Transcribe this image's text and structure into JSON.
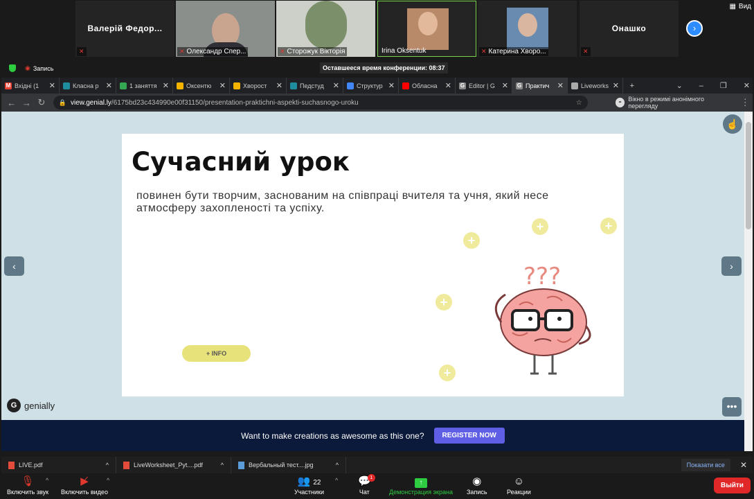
{
  "zoom": {
    "participants": [
      {
        "name": "Валерій Федор...",
        "caption": ""
      },
      {
        "name": "",
        "caption": "Олександр Спер..."
      },
      {
        "name": "",
        "caption": "Сторожук Вікторія"
      },
      {
        "name": "",
        "caption": "Irina Oksentuk"
      },
      {
        "name": "",
        "caption": "Катерина Хворо..."
      },
      {
        "name": "Онашко",
        "caption": ""
      }
    ],
    "view_label": "Вид",
    "recording_label": "Запись",
    "time_remaining": "Оставшееся время конференции: 08:37",
    "toolbar": {
      "unmute": "Включить звук",
      "start_video": "Включить видео",
      "participants": "Участники",
      "participants_count": "22",
      "chat": "Чат",
      "chat_badge": "1",
      "share_screen": "Демонстрация экрана",
      "record": "Запись",
      "reactions": "Реакции",
      "leave": "Выйти"
    }
  },
  "browser": {
    "tabs": [
      {
        "label": "Вхідні (1",
        "color": "#ea4335",
        "glyph": "M"
      },
      {
        "label": "Класна р",
        "color": "#1e8e9e",
        "glyph": ""
      },
      {
        "label": "1 заняття",
        "color": "#34a853",
        "glyph": ""
      },
      {
        "label": "Оксентю",
        "color": "#f4b400",
        "glyph": ""
      },
      {
        "label": "Хворост",
        "color": "#f4b400",
        "glyph": ""
      },
      {
        "label": "Педстуд",
        "color": "#1e8e9e",
        "glyph": ""
      },
      {
        "label": "Структур",
        "color": "#4285f4",
        "glyph": ""
      },
      {
        "label": "Обласна",
        "color": "#ff0000",
        "glyph": ""
      },
      {
        "label": "Editor | G",
        "color": "#888888",
        "glyph": "G"
      },
      {
        "label": "Практич",
        "color": "#888888",
        "glyph": "G",
        "active": true
      },
      {
        "label": "Liveworks",
        "color": "#aaaaaa",
        "glyph": ""
      }
    ],
    "url_domain": "view.genial.ly",
    "url_path": "/6175bd23c434990e00f31150/presentation-praktichni-aspekti-suchasnogo-uroku",
    "incognito": "Вікно в режимі анонімного перегляду"
  },
  "slide": {
    "title": "Сучасний урок",
    "body": "повинен бути творчим, заснованим на співпраці вчителя та учня, який несе атмосферу захопленості та успіху.",
    "info_button": "+ INFO",
    "question_marks": "???"
  },
  "genially": {
    "logo": "genially",
    "banner_text": "Want to make creations as awesome as this one?",
    "register": "REGISTER NOW"
  },
  "downloads": {
    "items": [
      {
        "name": "LIVE.pdf",
        "type": "pdf"
      },
      {
        "name": "LiveWorksheet_Pyt....pdf",
        "type": "pdf"
      },
      {
        "name": "Вербальный тест....jpg",
        "type": "img"
      }
    ],
    "show_all": "Показати все"
  }
}
